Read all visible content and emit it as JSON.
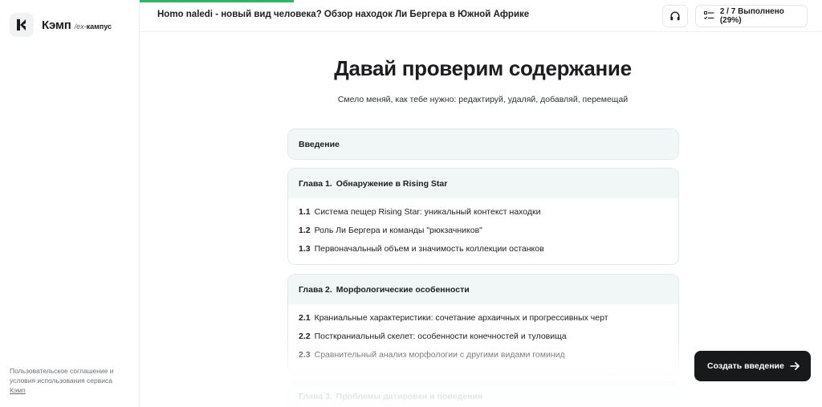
{
  "brand": {
    "name": "Кэмп",
    "sub_prefix": "/ex-",
    "sub_word": "кампус"
  },
  "footer": {
    "terms_text": "Пользовательское соглашение и условия использования сервиса",
    "terms_link": "Кэмп"
  },
  "topbar": {
    "doc_title": "Homo naledi - новый вид человека? Обзор находок Ли Бергера в Южной Африке",
    "status": "2 / 7 Выполнено (29%)",
    "progress_fraction": 0.29
  },
  "main": {
    "heading": "Давай проверим содержание",
    "subheading": "Смело меняй, как тебе нужно: редактируй, удаляй, добавляй, перемещай"
  },
  "outline": [
    {
      "title": "Введение",
      "items": []
    },
    {
      "number": "Глава 1.",
      "title": "Обнаружение в Rising Star",
      "items": [
        {
          "number": "1.1",
          "text": "Система пещер Rising Star: уникальный контекст находки"
        },
        {
          "number": "1.2",
          "text": "Роль Ли Бергера и команды \"рюкзачников\""
        },
        {
          "number": "1.3",
          "text": "Первоначальный объем и значимость коллекции останков"
        }
      ]
    },
    {
      "number": "Глава 2.",
      "title": "Морфологические особенности",
      "items": [
        {
          "number": "2.1",
          "text": "Краниальные характеристики: сочетание архаичных и прогрессивных черт"
        },
        {
          "number": "2.2",
          "text": "Посткраниальный скелет: особенности конечностей и туловища"
        },
        {
          "number": "2.3",
          "text": "Сравнительный анализ морфологии с другими видами гоминид"
        }
      ]
    },
    {
      "number": "Глава 3.",
      "title": "Проблемы датировки и поведения",
      "items": []
    }
  ],
  "cta": {
    "label": "Создать введение"
  },
  "colors": {
    "accent_progress": "#2fb36a",
    "cta_bg": "#17191b",
    "card_head_bg": "#f1f6f7"
  }
}
